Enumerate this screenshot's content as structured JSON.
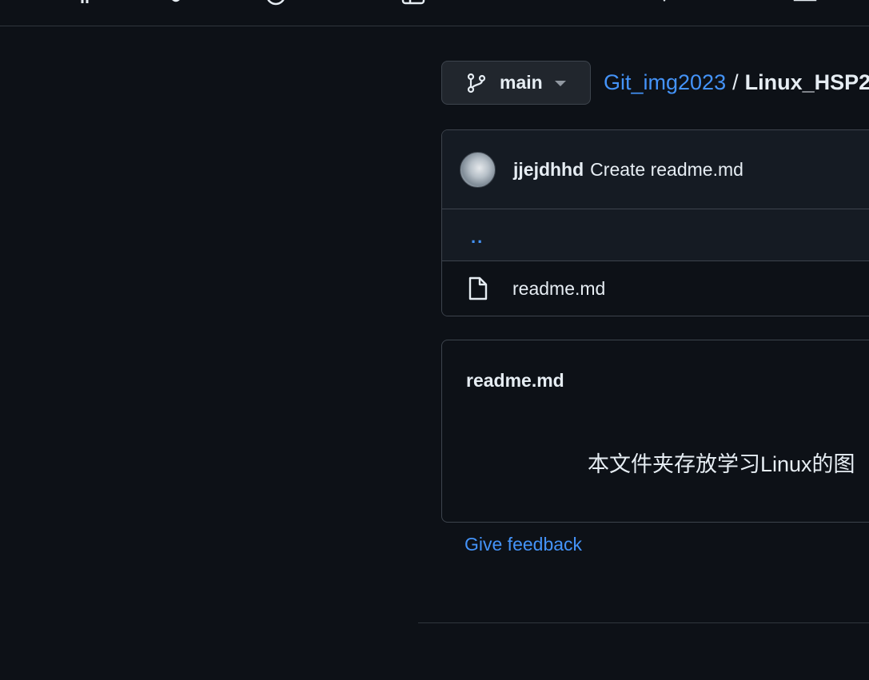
{
  "branch": {
    "label": "main",
    "icon": "git-branch-icon"
  },
  "breadcrumb": {
    "repo": "Git_img2023",
    "separator": "/",
    "current": "Linux_HSP2"
  },
  "latest_commit": {
    "author": "jjejdhhd",
    "message": "Create readme.md"
  },
  "file_list": {
    "parent_dir": "..",
    "files": [
      {
        "name": "readme.md",
        "icon": "file-icon"
      }
    ]
  },
  "readme": {
    "title": "readme.md",
    "body": "本文件夹存放学习Linux的图"
  },
  "feedback_link": "Give feedback",
  "colors": {
    "background": "#0d1117",
    "surface": "#151b23",
    "border": "#3d444d",
    "link": "#4493f8",
    "text": "#e6edf3"
  }
}
